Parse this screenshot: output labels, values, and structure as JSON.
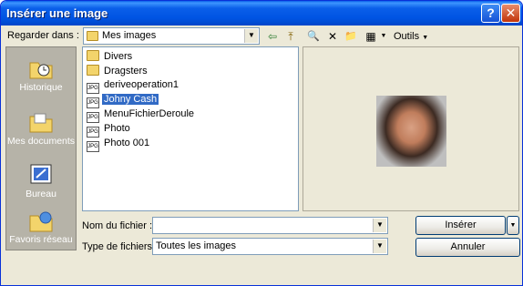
{
  "window": {
    "title": "Insérer une image"
  },
  "titlebar": {
    "help_glyph": "?",
    "close_glyph": "✕"
  },
  "lookin": {
    "label": "Regarder dans :",
    "value": "Mes images"
  },
  "toolbar": {
    "back": "⇦",
    "up": "⤒",
    "search_web": "🔍",
    "delete": "✕",
    "new_folder": "📁",
    "views": "▦",
    "tools_label": "Outils"
  },
  "places": [
    {
      "label": "Historique",
      "icon": "history-icon"
    },
    {
      "label": "Mes documents",
      "icon": "documents-icon"
    },
    {
      "label": "Bureau",
      "icon": "desktop-icon"
    },
    {
      "label": "Favoris réseau",
      "icon": "network-icon"
    }
  ],
  "files": [
    {
      "name": "Divers",
      "type": "folder"
    },
    {
      "name": "Dragsters",
      "type": "folder"
    },
    {
      "name": "deriveoperation1",
      "type": "image"
    },
    {
      "name": "Johny Cash",
      "type": "image"
    },
    {
      "name": "MenuFichierDeroule",
      "type": "image"
    },
    {
      "name": "Photo",
      "type": "image"
    },
    {
      "name": "Photo 001",
      "type": "image"
    }
  ],
  "selected_file": "Johny Cash",
  "filename": {
    "label": "Nom du fichier :",
    "value": ""
  },
  "filetype": {
    "label": "Type de fichiers :",
    "value": "Toutes les images"
  },
  "buttons": {
    "insert": "Insérer",
    "cancel": "Annuler"
  },
  "colors": {
    "titlebar": "#0054e3",
    "selection": "#316ac5",
    "places_bg": "#b6b3a8",
    "dialog_bg": "#ece9d8"
  }
}
